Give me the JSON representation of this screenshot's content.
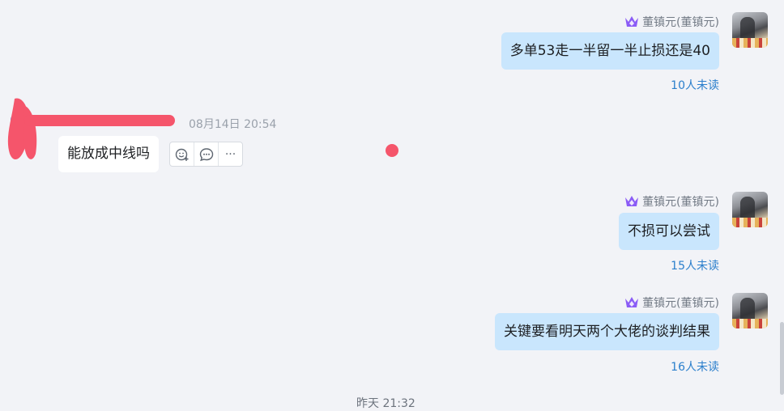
{
  "colors": {
    "background": "#f2f3f7",
    "bubble_self": "#c9e6fd",
    "bubble_other": "#ffffff",
    "unread_text": "#2b7fcc",
    "crown": "#8b5cf6",
    "redaction": "#f5556b"
  },
  "messages_right": [
    {
      "sender": "董镇元(董镇元)",
      "text": "多单53走一半留一半止损还是40",
      "unread": "10人未读",
      "icon": "crown-icon"
    },
    {
      "sender": "董镇元(董镇元)",
      "text": "不损可以尝试",
      "unread": "15人未读",
      "icon": "crown-icon"
    },
    {
      "sender": "董镇元(董镇元)",
      "text": "关键要看明天两个大佬的谈判结果",
      "unread": "16人未读",
      "icon": "crown-icon"
    }
  ],
  "message_left": {
    "time": "08月14日 20:54",
    "text": "能放成中线吗",
    "actions": [
      "emoji-add-icon",
      "reply-icon",
      "more-icon"
    ],
    "more_label": "···"
  },
  "bottom_partial_text": "昨天 21:32"
}
